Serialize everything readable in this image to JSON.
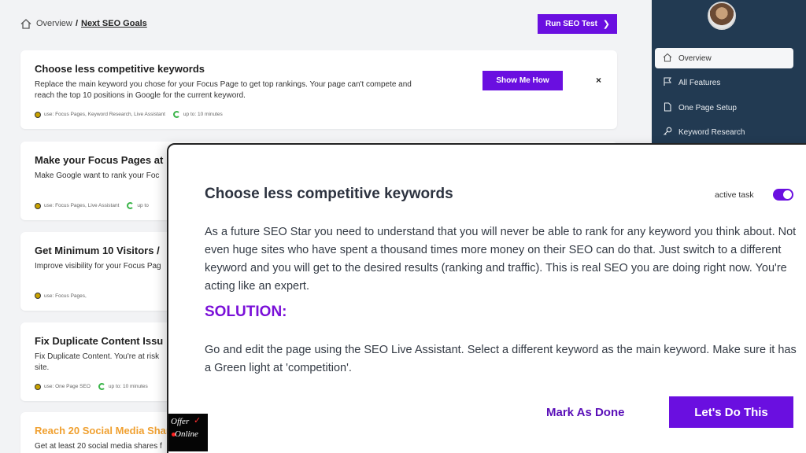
{
  "breadcrumb": {
    "overview": "Overview",
    "separator": "/",
    "current": "Next SEO Goals"
  },
  "toolbar": {
    "run_seo_test": "Run SEO Test"
  },
  "cards": [
    {
      "title": "Choose less competitive keywords",
      "desc_line1": "Replace the main keyword you chose for your Focus Page to get top rankings. Your page can't compete and",
      "desc_line2": "reach the top 10 positions in Google for the current keyword.",
      "meta_use": "use: Focus Pages, Keyword Research, Live Assistant",
      "meta_time": "up to: 10 minutes",
      "button": "Show Me How",
      "close": "×"
    },
    {
      "title": "Make your Focus Pages at",
      "desc_line1": "Make Google want to rank your Foc",
      "meta_use": "use: Focus Pages, Live Assistant",
      "meta_time": "up to"
    },
    {
      "title": "Get Minimum 10 Visitors /",
      "desc_line1": "Improve visibility for your Focus Pag",
      "meta_use": "use: Focus Pages,"
    },
    {
      "title": "Fix Duplicate Content Issu",
      "desc_line1": "Fix Duplicate Content. You're at risk",
      "desc_line2": "site.",
      "meta_use": "use: One Page SEO",
      "meta_time": "up to: 10 minutes"
    },
    {
      "title": "Reach 20 Social Media Shar",
      "desc_line1": "Get at least 20 social media shares f"
    }
  ],
  "sidebar": {
    "items": [
      {
        "label": "Overview",
        "icon": "home-icon"
      },
      {
        "label": "All Features",
        "icon": "flag-icon"
      },
      {
        "label": "One Page Setup",
        "icon": "page-icon"
      },
      {
        "label": "Keyword Research",
        "icon": "key-icon"
      }
    ]
  },
  "modal": {
    "title": "Choose less competitive keywords",
    "active_task_label": "active task",
    "active_task_on": true,
    "body": "As a future SEO Star you need to understand that you will never be able to rank for any keyword you think about. Not even huge sites who have spent a thousand times more money on their SEO can do that. Just switch to a different keyword and you will get to the desired results (ranking and traffic). This is real SEO you are doing right now. You're acting like an expert.",
    "solution_heading": "SOLUTION:",
    "solution_body": "Go and edit the page using the SEO Live Assistant. Select a different keyword as the main keyword. Make sure it has a Green light at 'competition'.",
    "mark_done": "Mark As Done",
    "do_this": "Let's Do This"
  },
  "watermark": {
    "line1": "Offer",
    "line2": "Online"
  },
  "colors": {
    "accent": "#6a0fe0",
    "sidebar": "#223a52",
    "solution": "#7a10d8",
    "highlight_title": "#f0a030"
  }
}
